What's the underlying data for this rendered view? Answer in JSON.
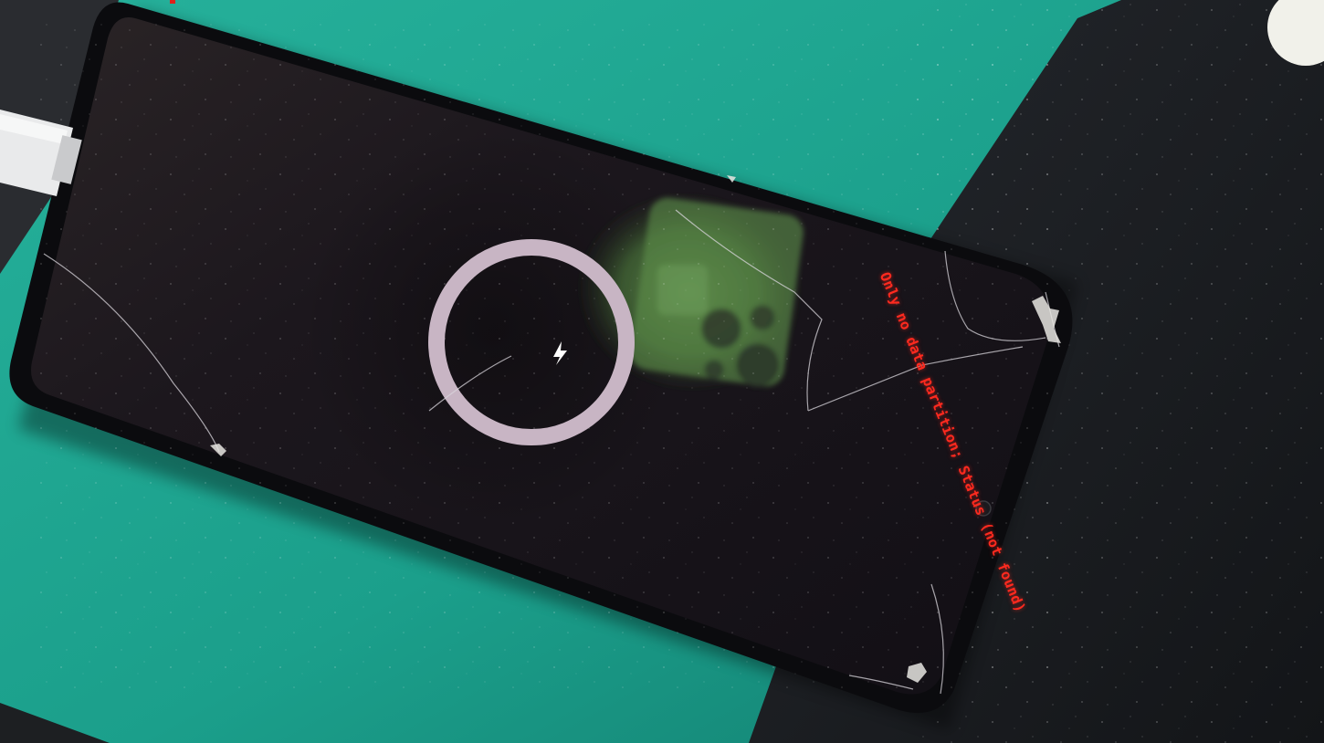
{
  "scene": {
    "objects": [
      "smartphone",
      "cracked-screen",
      "charging-ring",
      "lightning-bolt-icon",
      "usb-cable",
      "teal-work-mat",
      "dark-anti-static-mat",
      "reflected-green-phone"
    ]
  },
  "screen": {
    "debug_text": "Only no data partition; Status (not found)",
    "debug_text_color": "#ff2a1f",
    "charging_ring_color": "#c8b5c4",
    "bolt_color": "#ffffff"
  },
  "colors": {
    "mat_teal": "#1fa591",
    "mat_teal_dark": "#117d70",
    "black_mat": "#1b1d21",
    "phone_screen": "#17141b",
    "phone_frame": "#0b0b0e",
    "reflection_green": "#5c8c4a",
    "cable": "#e9eaeb"
  }
}
